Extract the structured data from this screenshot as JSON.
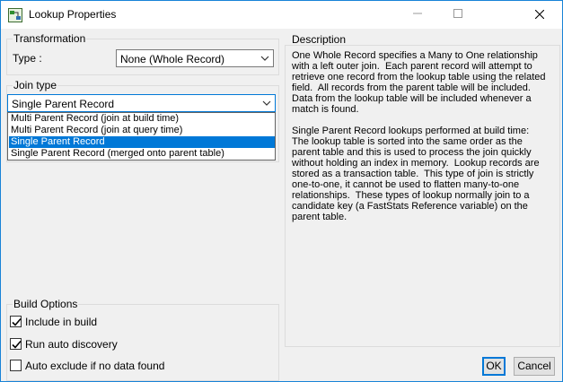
{
  "window": {
    "title": "Lookup Properties"
  },
  "transformation": {
    "group_label": "Transformation",
    "type_label": "Type :",
    "type_value": "None (Whole Record)"
  },
  "join_type": {
    "group_label": "Join type",
    "selected": "Single Parent Record",
    "options": [
      "Multi Parent Record (join at build time)",
      "Multi Parent Record (join at query time)",
      "Single Parent Record",
      "Single Parent Record (merged onto parent table)"
    ],
    "highlighted_index": 2
  },
  "description": {
    "group_label": "Description",
    "text": "One Whole Record specifies a Many to One relationship\nwith a left outer join.  Each parent record will attempt to\nretrieve one record from the lookup table using the related\nfield.  All records from the parent table will be included.\nData from the lookup table will be included whenever a\nmatch is found.\n\nSingle Parent Record lookups performed at build time:\nThe lookup table is sorted into the same order as the\nparent table and this is used to process the join quickly\nwithout holding an index in memory.  Lookup records are\nstored as a transaction table.  This type of join is strictly\none-to-one, it cannot be used to flatten many-to-one\nrelationships.  These types of lookup normally join to a\ncandidate key (a FastStats Reference variable) on the\nparent table."
  },
  "build_options": {
    "group_label": "Build Options",
    "items": [
      {
        "label": "Include in build",
        "checked": true
      },
      {
        "label": "Run auto discovery",
        "checked": true
      },
      {
        "label": "Auto exclude if no data found",
        "checked": false
      }
    ]
  },
  "buttons": {
    "ok": "OK",
    "cancel": "Cancel"
  },
  "colors": {
    "accent": "#0078d7",
    "window_border": "#1883d7",
    "dialog_bg": "#f0f0f0"
  }
}
